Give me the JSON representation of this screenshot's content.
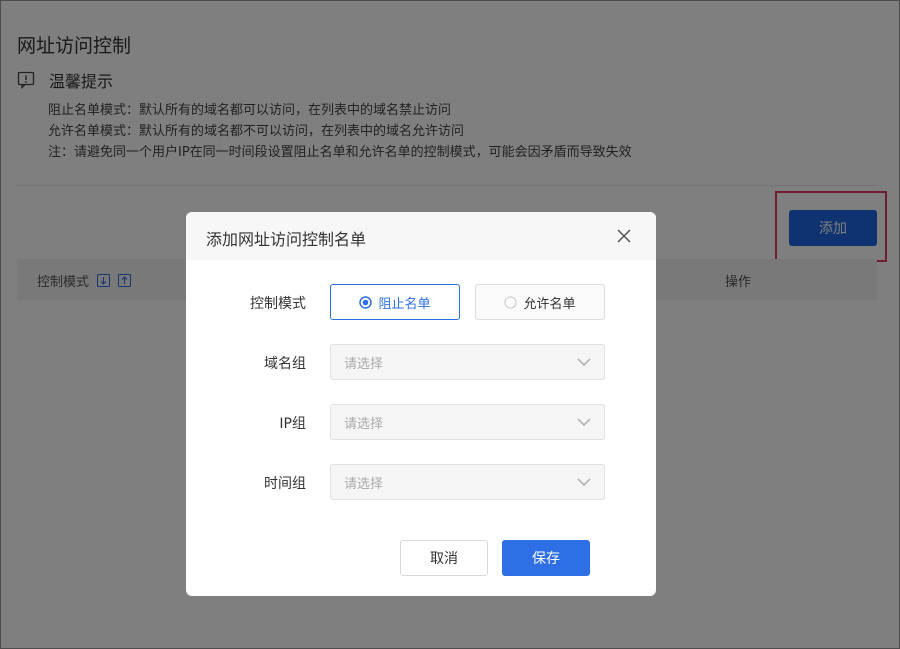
{
  "page": {
    "title": "网址访问控制",
    "tips_title": "温馨提示",
    "tips": [
      "阻止名单模式：默认所有的域名都可以访问，在列表中的域名禁止访问",
      "允许名单模式：默认所有的域名都不可以访问，在列表中的域名允许访问",
      "注：请避免同一个用户IP在同一时间段设置阻止名单和允许名单的控制模式，可能会因矛盾而导致失效"
    ],
    "add_label": "添加"
  },
  "table": {
    "col_mode": "控制模式",
    "col_op": "操作"
  },
  "modal": {
    "title": "添加网址访问控制名单",
    "mode_label": "控制模式",
    "mode_options": [
      "阻止名单",
      "允许名单"
    ],
    "mode_selected": "阻止名单",
    "domain_label": "域名组",
    "ip_label": "IP组",
    "time_label": "时间组",
    "placeholder": "请选择",
    "cancel_label": "取消",
    "save_label": "保存"
  },
  "colors": {
    "primary": "#2f6fe6",
    "add_button": "#1f66e0",
    "highlight": "#e53b5f"
  }
}
